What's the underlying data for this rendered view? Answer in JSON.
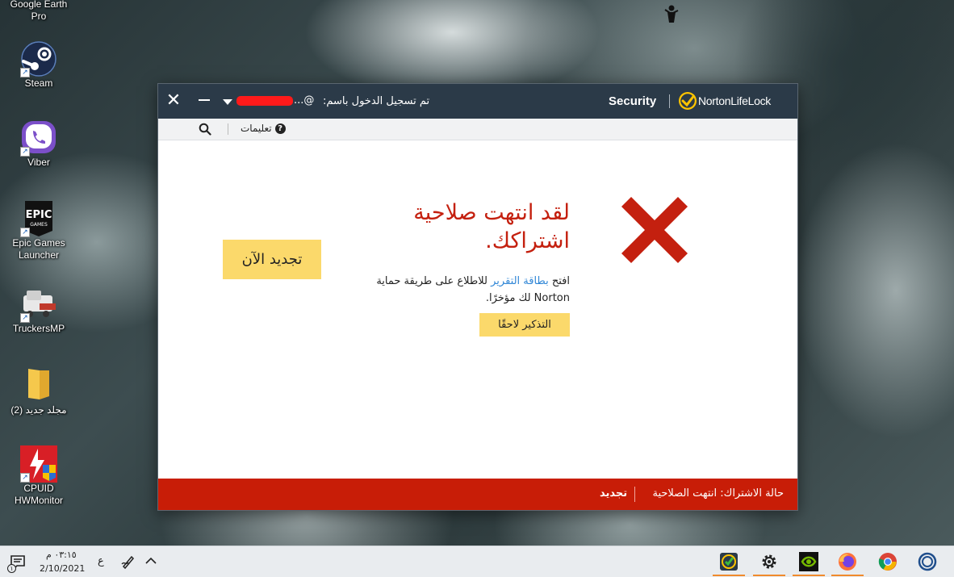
{
  "desktop": {
    "icons": [
      {
        "label": "Google Earth Pro"
      },
      {
        "label": "Steam"
      },
      {
        "label": "Viber"
      },
      {
        "label": "Epic Games Launcher"
      },
      {
        "label": "TruckersMP"
      },
      {
        "label": "مجلد جديد (2)"
      },
      {
        "label": "CPUID HWMonitor"
      }
    ]
  },
  "norton": {
    "titlebar": {
      "close_glyph": "✕",
      "logged_in_label": "تم تسجيل الدخول باسم:",
      "account_suffix": "...@",
      "product": "Security",
      "brand": "NortonLifeLock"
    },
    "toolbar": {
      "help_label": "تعليمات",
      "help_glyph": "?"
    },
    "main": {
      "headline": "لقد انتهت صلاحية اشتراكك.",
      "sub_prefix": "افتح",
      "sub_link": "بطاقة التقرير",
      "sub_suffix": "للاطلاع على طريقة حماية Norton لك مؤخرًا.",
      "remind_label": "التذكير لاحقًا",
      "renew_now_label": "تجديد الآن"
    },
    "footer": {
      "status_label": "حالة الاشتراك:",
      "status_value": "انتهت الصلاحية",
      "renew_label": "تجديد"
    },
    "colors": {
      "titlebar": "#2b3a48",
      "alert_red": "#c81d07",
      "button_yellow": "#fbd96b",
      "link_blue": "#2f86d6"
    }
  },
  "taskbar": {
    "clock_time": "٠٣:١٥ م",
    "clock_date": "2/10/2021",
    "language": "ع",
    "notification_badge": "١",
    "apps": [
      {
        "icon": "norton-app-icon"
      },
      {
        "icon": "settings-gear-icon"
      },
      {
        "icon": "nvidia-icon"
      },
      {
        "icon": "firefox-icon"
      },
      {
        "icon": "chrome-icon"
      },
      {
        "icon": "cortana-ring-icon"
      }
    ]
  }
}
